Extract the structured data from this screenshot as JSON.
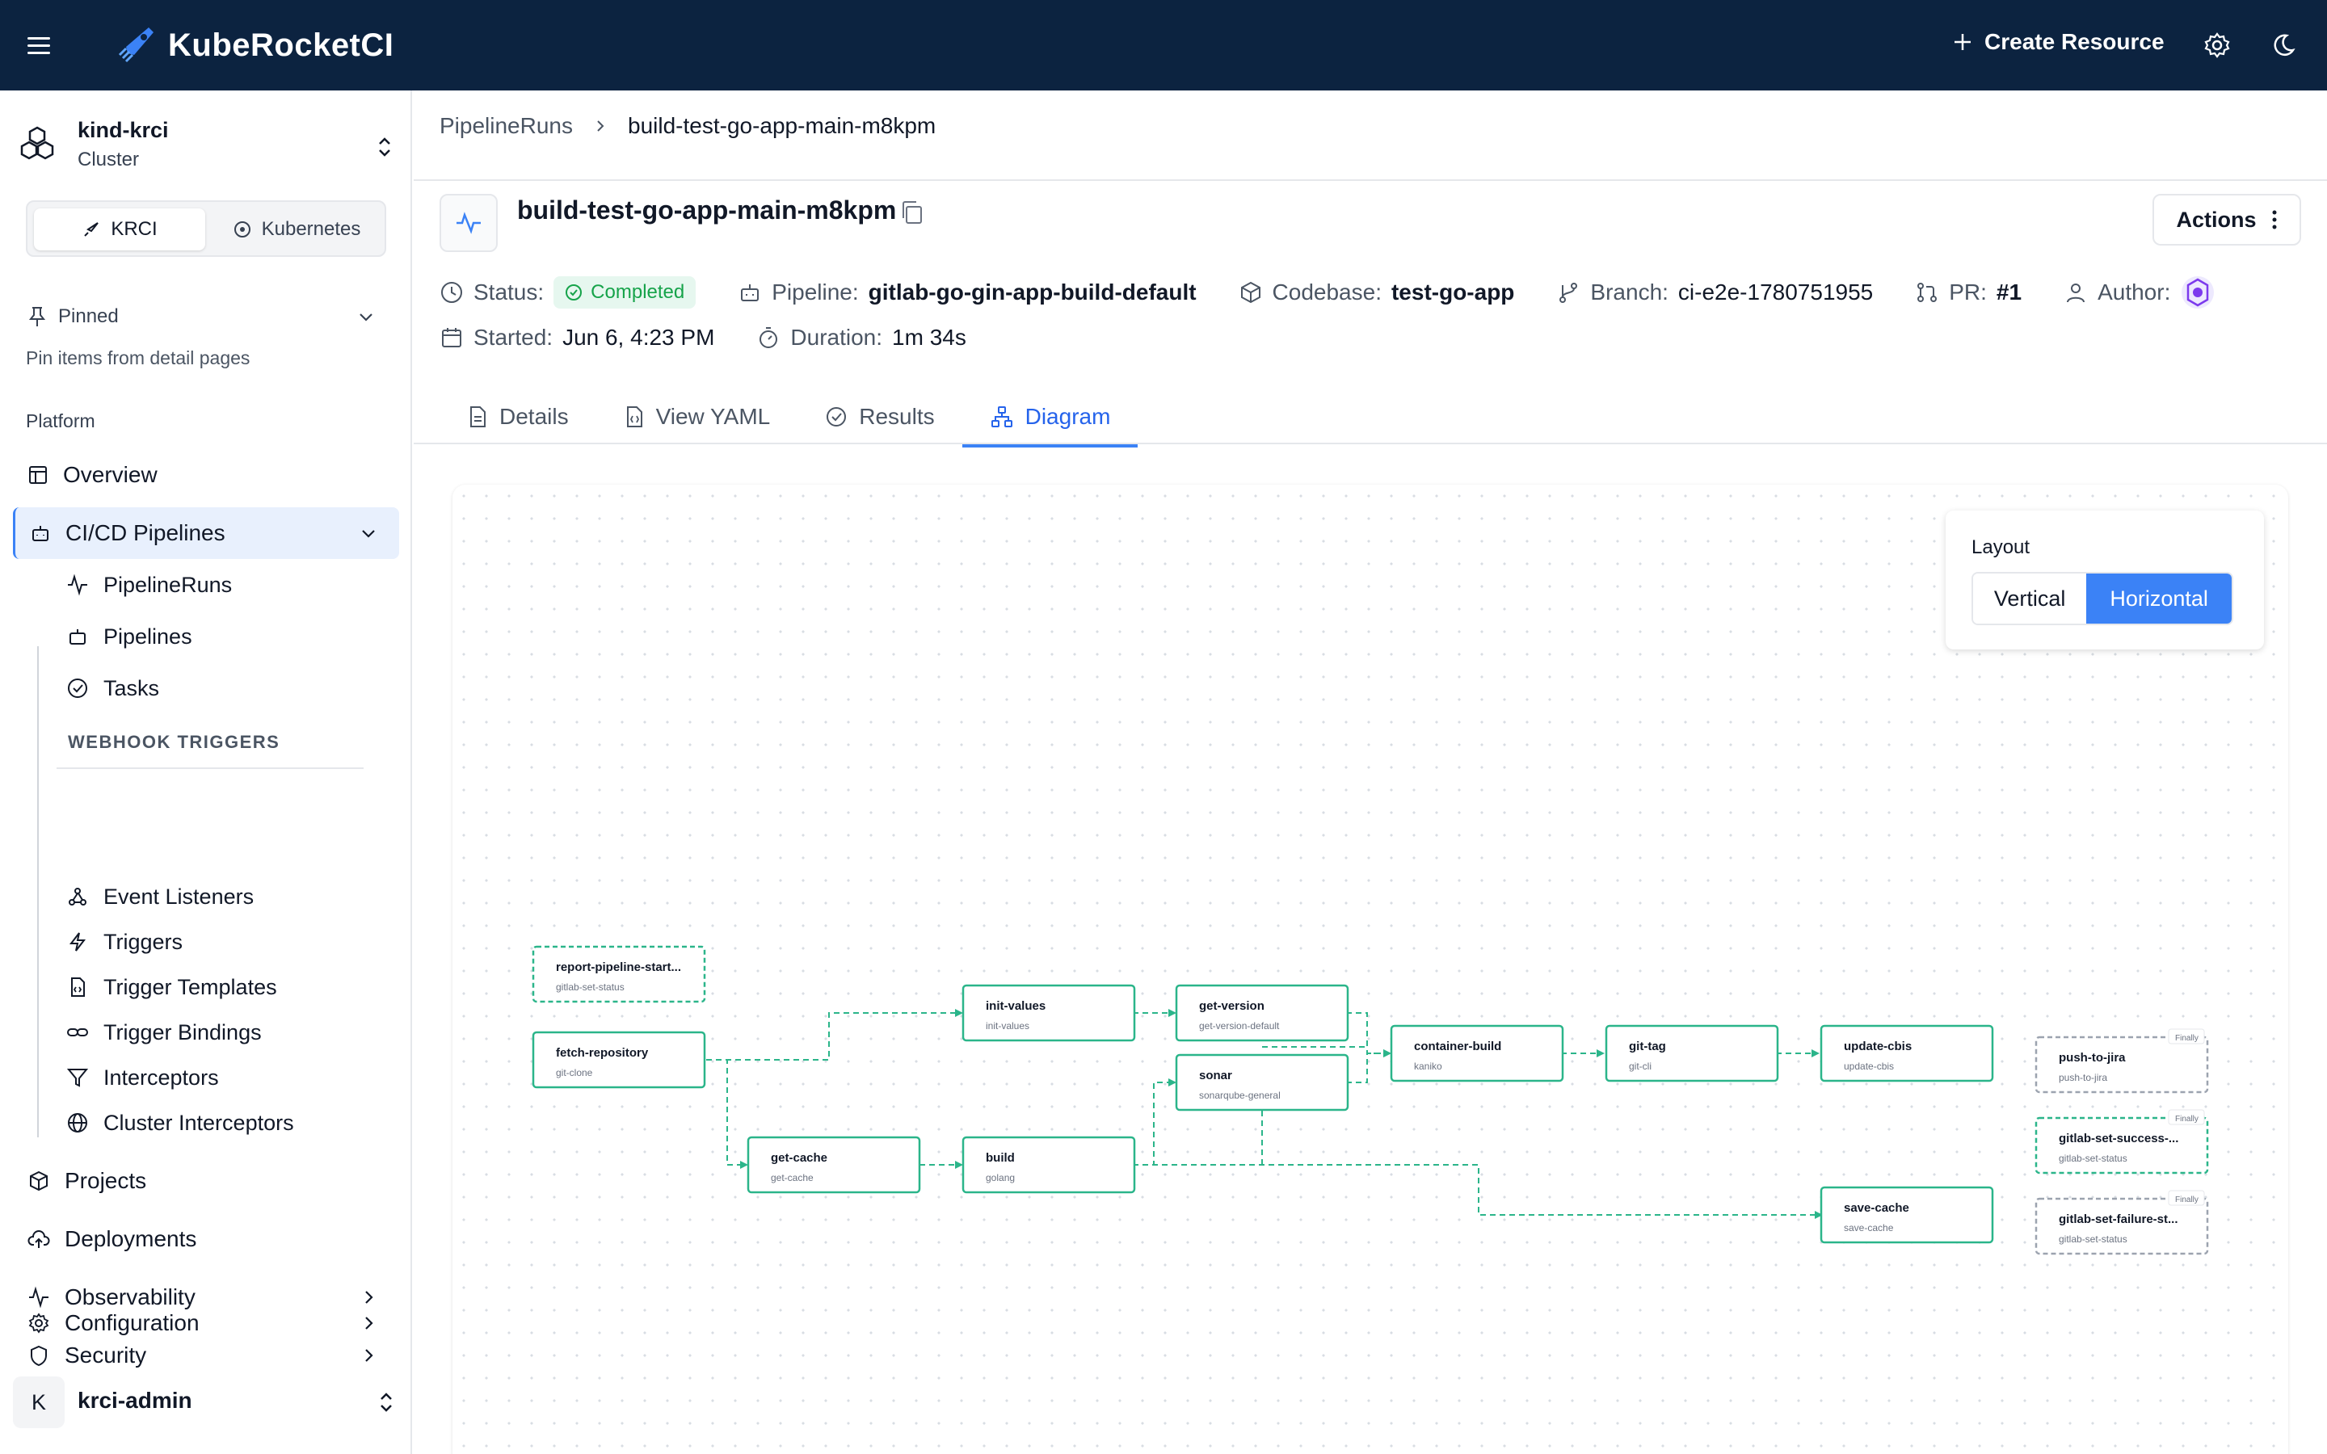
{
  "app": {
    "title": "KubeRocketCI",
    "create_label": "Create Resource"
  },
  "cluster": {
    "name": "kind-krci",
    "type": "Cluster"
  },
  "switcher": {
    "krci": "KRCI",
    "kubernetes": "Kubernetes"
  },
  "pinned": {
    "label": "Pinned",
    "hint": "Pin items from detail pages"
  },
  "platform_label": "Platform",
  "nav": {
    "overview": "Overview",
    "cicd": "CI/CD Pipelines",
    "pipelineruns": "PipelineRuns",
    "pipelines": "Pipelines",
    "tasks": "Tasks",
    "webhook_triggers": "WEBHOOK TRIGGERS",
    "event_listeners": "Event Listeners",
    "triggers": "Triggers",
    "trigger_templates": "Trigger Templates",
    "trigger_bindings": "Trigger Bindings",
    "interceptors": "Interceptors",
    "cluster_interceptors": "Cluster Interceptors",
    "projects": "Projects",
    "deployments": "Deployments",
    "observability": "Observability",
    "security": "Security",
    "configuration": "Configuration"
  },
  "user": {
    "initial": "K",
    "name": "krci-admin"
  },
  "breadcrumb": {
    "parent": "PipelineRuns",
    "current": "build-test-go-app-main-m8kpm"
  },
  "page": {
    "title": "build-test-go-app-main-m8kpm",
    "actions_label": "Actions",
    "status_label": "Status:",
    "status_value": "Completed",
    "pipeline_label": "Pipeline:",
    "pipeline_value": "gitlab-go-gin-app-build-default",
    "codebase_label": "Codebase:",
    "codebase_value": "test-go-app",
    "branch_label": "Branch:",
    "branch_value": "ci-e2e-1780751955",
    "pr_label": "PR:",
    "pr_value": "#1",
    "author_label": "Author:",
    "started_label": "Started:",
    "started_value": "Jun 6, 4:23 PM",
    "duration_label": "Duration:",
    "duration_value": "1m 34s"
  },
  "tabs": [
    "Details",
    "View YAML",
    "Results",
    "Diagram"
  ],
  "diagram": {
    "layout_label": "Layout",
    "layout_options": [
      "Vertical",
      "Horizontal"
    ],
    "selected_layout": "Horizontal",
    "finally_badge": "Finally",
    "nodes": [
      {
        "id": "report",
        "name": "report-pipeline-start...",
        "ref": "gitlab-set-status"
      },
      {
        "id": "fetch",
        "name": "fetch-repository",
        "ref": "git-clone"
      },
      {
        "id": "init",
        "name": "init-values",
        "ref": "init-values"
      },
      {
        "id": "getver",
        "name": "get-version",
        "ref": "get-version-default"
      },
      {
        "id": "sonar",
        "name": "sonar",
        "ref": "sonarqube-general"
      },
      {
        "id": "getcache",
        "name": "get-cache",
        "ref": "get-cache"
      },
      {
        "id": "build",
        "name": "build",
        "ref": "golang"
      },
      {
        "id": "cbuild",
        "name": "container-build",
        "ref": "kaniko"
      },
      {
        "id": "gittag",
        "name": "git-tag",
        "ref": "git-cli"
      },
      {
        "id": "cbis",
        "name": "update-cbis",
        "ref": "update-cbis"
      },
      {
        "id": "savecache",
        "name": "save-cache",
        "ref": "save-cache"
      },
      {
        "id": "jira",
        "name": "push-to-jira",
        "ref": "push-to-jira"
      },
      {
        "id": "success",
        "name": "gitlab-set-success-...",
        "ref": "gitlab-set-status"
      },
      {
        "id": "failure",
        "name": "gitlab-set-failure-st...",
        "ref": "gitlab-set-status"
      }
    ]
  },
  "colors": {
    "topbar": "#0c2340",
    "accent": "#3b82f6",
    "node": "#2bb58a",
    "success": "#16a34a"
  }
}
